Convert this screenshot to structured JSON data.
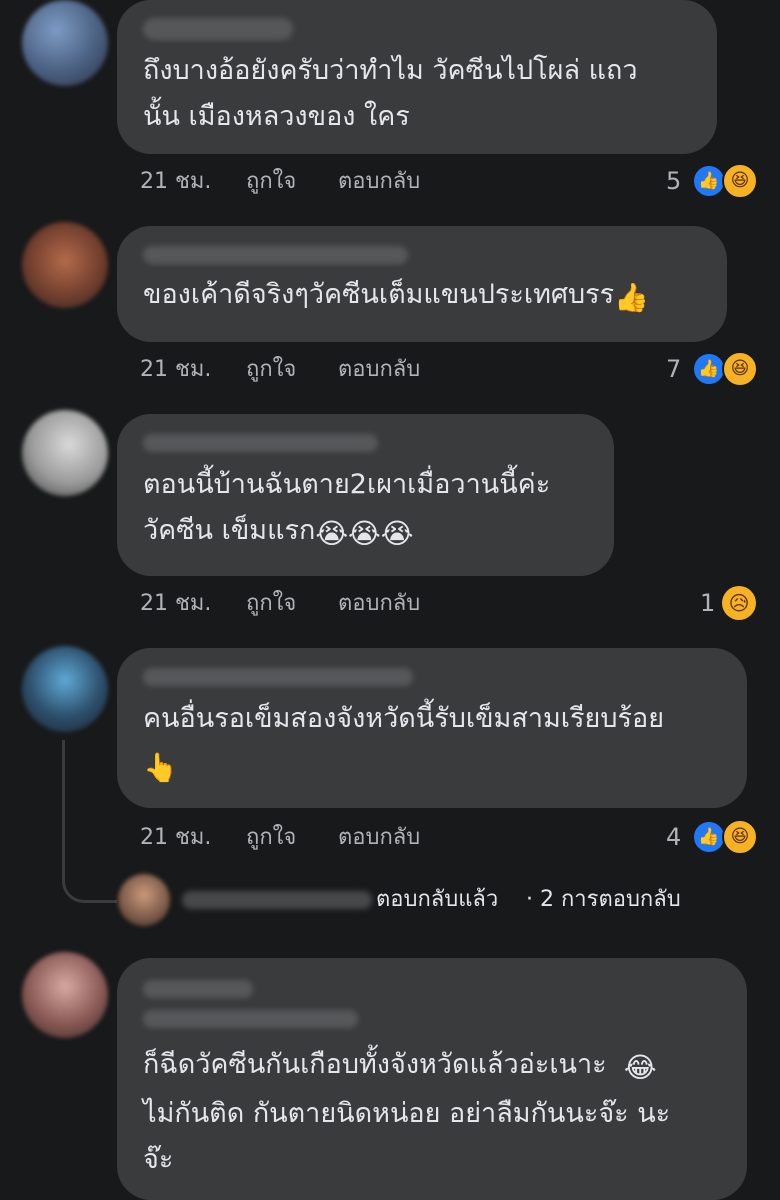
{
  "comments": [
    {
      "text_lines": [
        "ถึงบางอ้อยังครับว่าทำไม วัคซีนไปโผล่ แถว",
        "นั้น เมืองหลวงของ ใคร"
      ],
      "time": "21 ชม.",
      "like": "ถูกใจ",
      "reply": "ตอบกลับ",
      "reaction_count": "5",
      "reactions": [
        "like",
        "haha"
      ]
    },
    {
      "text_lines": [
        "ของเค้าดีจริงๆวัคซีนเต็มแขนประเทศบรร"
      ],
      "emoji_end": "👍",
      "time": "21 ชม.",
      "like": "ถูกใจ",
      "reply": "ตอบกลับ",
      "reaction_count": "7",
      "reactions": [
        "like",
        "haha"
      ]
    },
    {
      "text_lines": [
        "ตอนนี้บ้านฉันตาย2เผาเมื่อวานนี้ค่ะ",
        "วัคซีน เข็มแรก"
      ],
      "emoji_end": "😭😭😭",
      "time": "21 ชม.",
      "like": "ถูกใจ",
      "reply": "ตอบกลับ",
      "reaction_count": "1",
      "reactions": [
        "sad"
      ]
    },
    {
      "text_lines": [
        "คนอื่นรอเข็มสองจังหวัดนี้รับเข็มสามเรียบร้อย"
      ],
      "emoji_line": "👆",
      "time": "21 ชม.",
      "like": "ถูกใจ",
      "reply": "ตอบกลับ",
      "reaction_count": "4",
      "reactions": [
        "like",
        "haha"
      ],
      "replies_summary": {
        "action": "ตอบกลับแล้ว",
        "count": "· 2 การตอบกลับ"
      }
    },
    {
      "text_lines": [
        "ก็ฉีดวัคซีนกันเกือบทั้งจังหวัดแล้วอ่ะเนาะ",
        "ไม่กันติด กันตายนิดหน่อย อย่าลืมกันนะจ๊ะ นะ",
        "จ๊ะ"
      ],
      "emoji_mid": "😂"
    }
  ],
  "colors": {
    "background": "#18191a",
    "bubble": "#3a3b3c",
    "like": "#2078f4",
    "haha": "#f7b125"
  },
  "icons": {
    "like": "thumbs-up-icon",
    "haha": "laughing-face-icon",
    "sad": "sad-face-icon"
  }
}
